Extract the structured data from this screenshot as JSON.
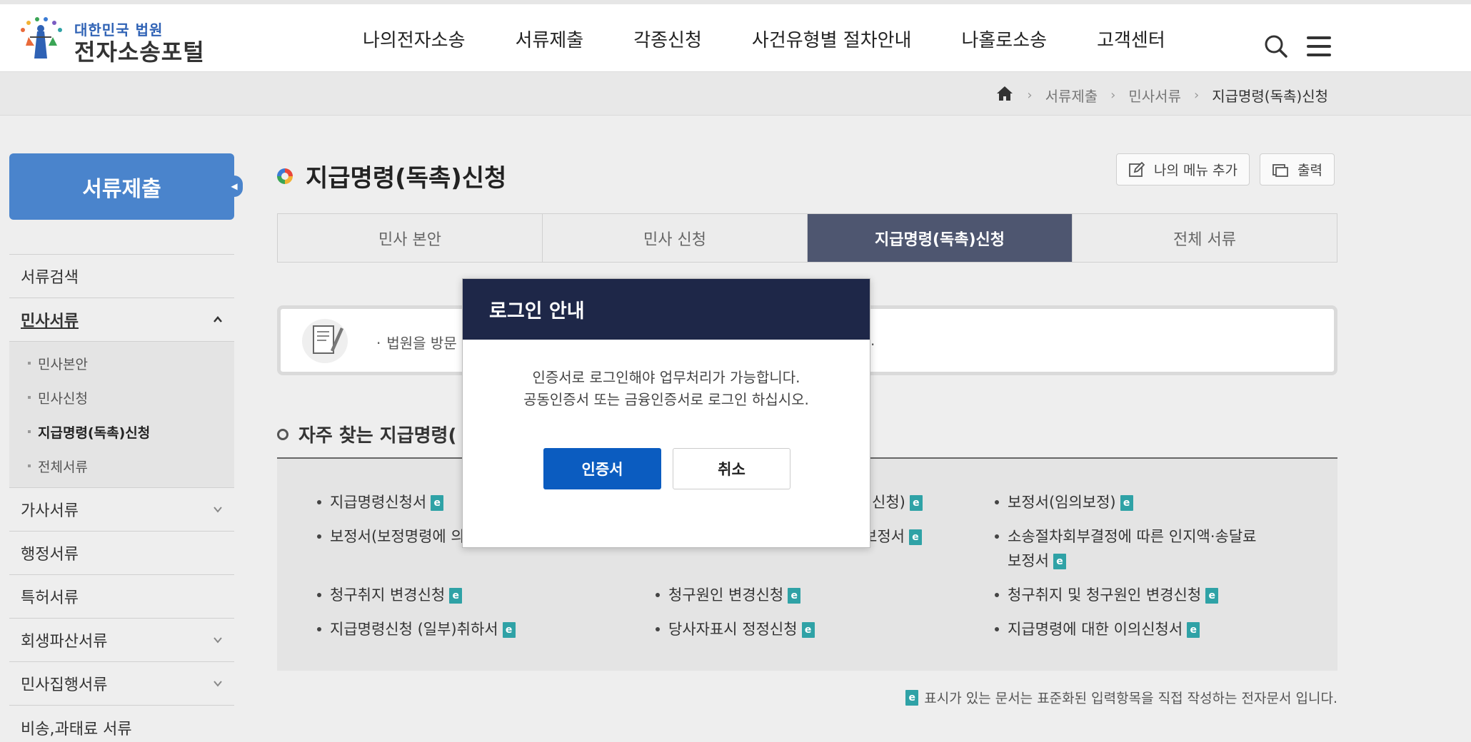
{
  "header": {
    "logo_small": "대한민국 법원",
    "logo_big": "전자소송포털",
    "nav": [
      "나의전자소송",
      "서류제출",
      "각종신청",
      "사건유형별 절차안내",
      "나홀로소송",
      "고객센터"
    ]
  },
  "breadcrumb": {
    "items": [
      "서류제출",
      "민사서류",
      "지급명령(독촉)신청"
    ]
  },
  "sidebar": {
    "title": "서류제출",
    "items": [
      {
        "label": "서류검색"
      },
      {
        "label": "민사서류"
      },
      {
        "label": "가사서류"
      },
      {
        "label": "행정서류"
      },
      {
        "label": "특허서류"
      },
      {
        "label": "회생파산서류"
      },
      {
        "label": "민사집행서류"
      },
      {
        "label": "비송,과태료 서류"
      }
    ],
    "sub_items": [
      "민사본안",
      "민사신청",
      "지급명령(독촉)신청",
      "전체서류"
    ]
  },
  "main": {
    "title": "지급명령(독촉)신청",
    "buttons": {
      "my_menu": "나의 메뉴 추가",
      "print": "출력"
    },
    "tabs": [
      "민사 본안",
      "민사 신청",
      "지급명령(독촉)신청",
      "전체 서류"
    ],
    "notice_left": "법원을 방문",
    "notice_right": ".",
    "section_title": "자주 찾는 지급명령(",
    "docs": [
      "지급명령신청서",
      "신청)",
      "보정서(임의보정)",
      "보정서(보정명령에 의",
      "보정서",
      "소송절차회부결정에 따른 인지액·송달료",
      "보정서",
      "청구취지 변경신청",
      "청구원인 변경신청",
      "청구취지 및 청구원인 변경신청",
      "지급명령신청 (일부)취하서",
      "당사자표시 정정신청",
      "지급명령에 대한 이의신청서"
    ],
    "e_badge": "e",
    "footnote": "표시가 있는 문서는 표준화된 입력항목을 직접 작성하는 전자문서 입니다."
  },
  "modal": {
    "title": "로그인 안내",
    "line1": "인증서로 로그인해야 업무처리가 가능합니다.",
    "line2": "공동인증서 또는 금융인증서로 로그인 하십시오.",
    "confirm": "인증서",
    "cancel": "취소"
  }
}
